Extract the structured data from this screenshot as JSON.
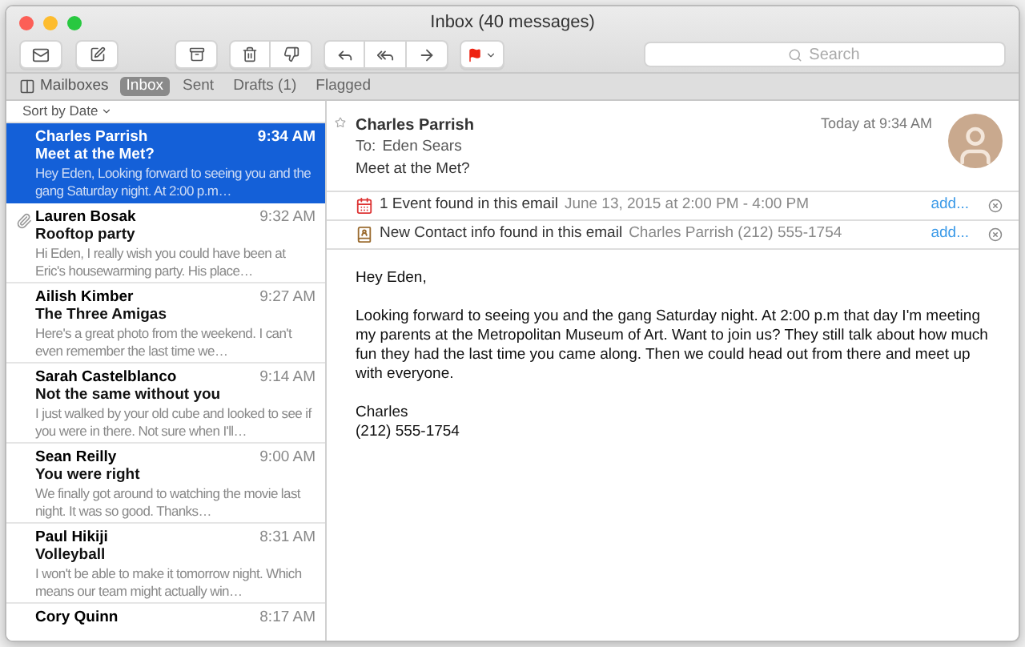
{
  "window": {
    "title": "Inbox (40 messages)"
  },
  "search": {
    "placeholder": "Search"
  },
  "mailboxes_button": {
    "label": "Mailboxes"
  },
  "tabs": [
    {
      "label": "Inbox",
      "selected": true
    },
    {
      "label": "Sent",
      "selected": false
    },
    {
      "label": "Drafts (1)",
      "selected": false
    },
    {
      "label": "Flagged",
      "selected": false
    }
  ],
  "sort": {
    "label": "Sort by Date"
  },
  "messages": [
    {
      "sender": "Charles Parrish",
      "time": "9:34 AM",
      "subject": "Meet at the Met?",
      "preview": "Hey Eden, Looking forward to seeing you and the gang Saturday night. At 2:00 p.m…",
      "attachment": false,
      "selected": true
    },
    {
      "sender": "Lauren Bosak",
      "time": "9:32 AM",
      "subject": "Rooftop party",
      "preview": "Hi Eden, I really wish you could have been at Eric's housewarming party. His place…",
      "attachment": true,
      "selected": false
    },
    {
      "sender": "Ailish Kimber",
      "time": "9:27 AM",
      "subject": "The Three Amigas",
      "preview": "Here's a great photo from the weekend. I can't even remember the last time we…",
      "attachment": false,
      "selected": false
    },
    {
      "sender": "Sarah Castelblanco",
      "time": "9:14 AM",
      "subject": "Not the same without you",
      "preview": "I just walked by your old cube and looked to see if you were in there. Not sure when I'll…",
      "attachment": false,
      "selected": false
    },
    {
      "sender": "Sean Reilly",
      "time": "9:00 AM",
      "subject": "You were right",
      "preview": "We finally got around to watching the movie last night. It was so good. Thanks…",
      "attachment": false,
      "selected": false
    },
    {
      "sender": "Paul Hikiji",
      "time": "8:31 AM",
      "subject": "Volleyball",
      "preview": "I won't be able to make it tomorrow night. Which means our team might actually win…",
      "attachment": false,
      "selected": false
    },
    {
      "sender": "Cory Quinn",
      "time": "8:17 AM",
      "attachment": false,
      "selected": false
    }
  ],
  "email": {
    "sender": "Charles Parrish",
    "to_label": "To:",
    "to": "Eden Sears",
    "date": "Today at 9:34 AM",
    "subject": "Meet at the Met?",
    "detections": [
      {
        "kind": "event",
        "label": "1 Event found in this email",
        "detail": "June 13, 2015 at 2:00 PM - 4:00 PM",
        "action": "add..."
      },
      {
        "kind": "contact",
        "label": "New Contact info found in this email",
        "detail": "Charles Parrish (212) 555-1754",
        "action": "add..."
      }
    ],
    "body": [
      "Hey Eden,",
      "Looking forward to seeing you and the gang Saturday night. At 2:00 p.m that day I'm meeting my parents at the Metropolitan Museum of Art. Want to join us? They still talk about how much fun they had the last time you came along. Then we could head out from there and meet up with everyone."
    ],
    "signature": [
      "Charles",
      "(212) 555-1754"
    ]
  }
}
